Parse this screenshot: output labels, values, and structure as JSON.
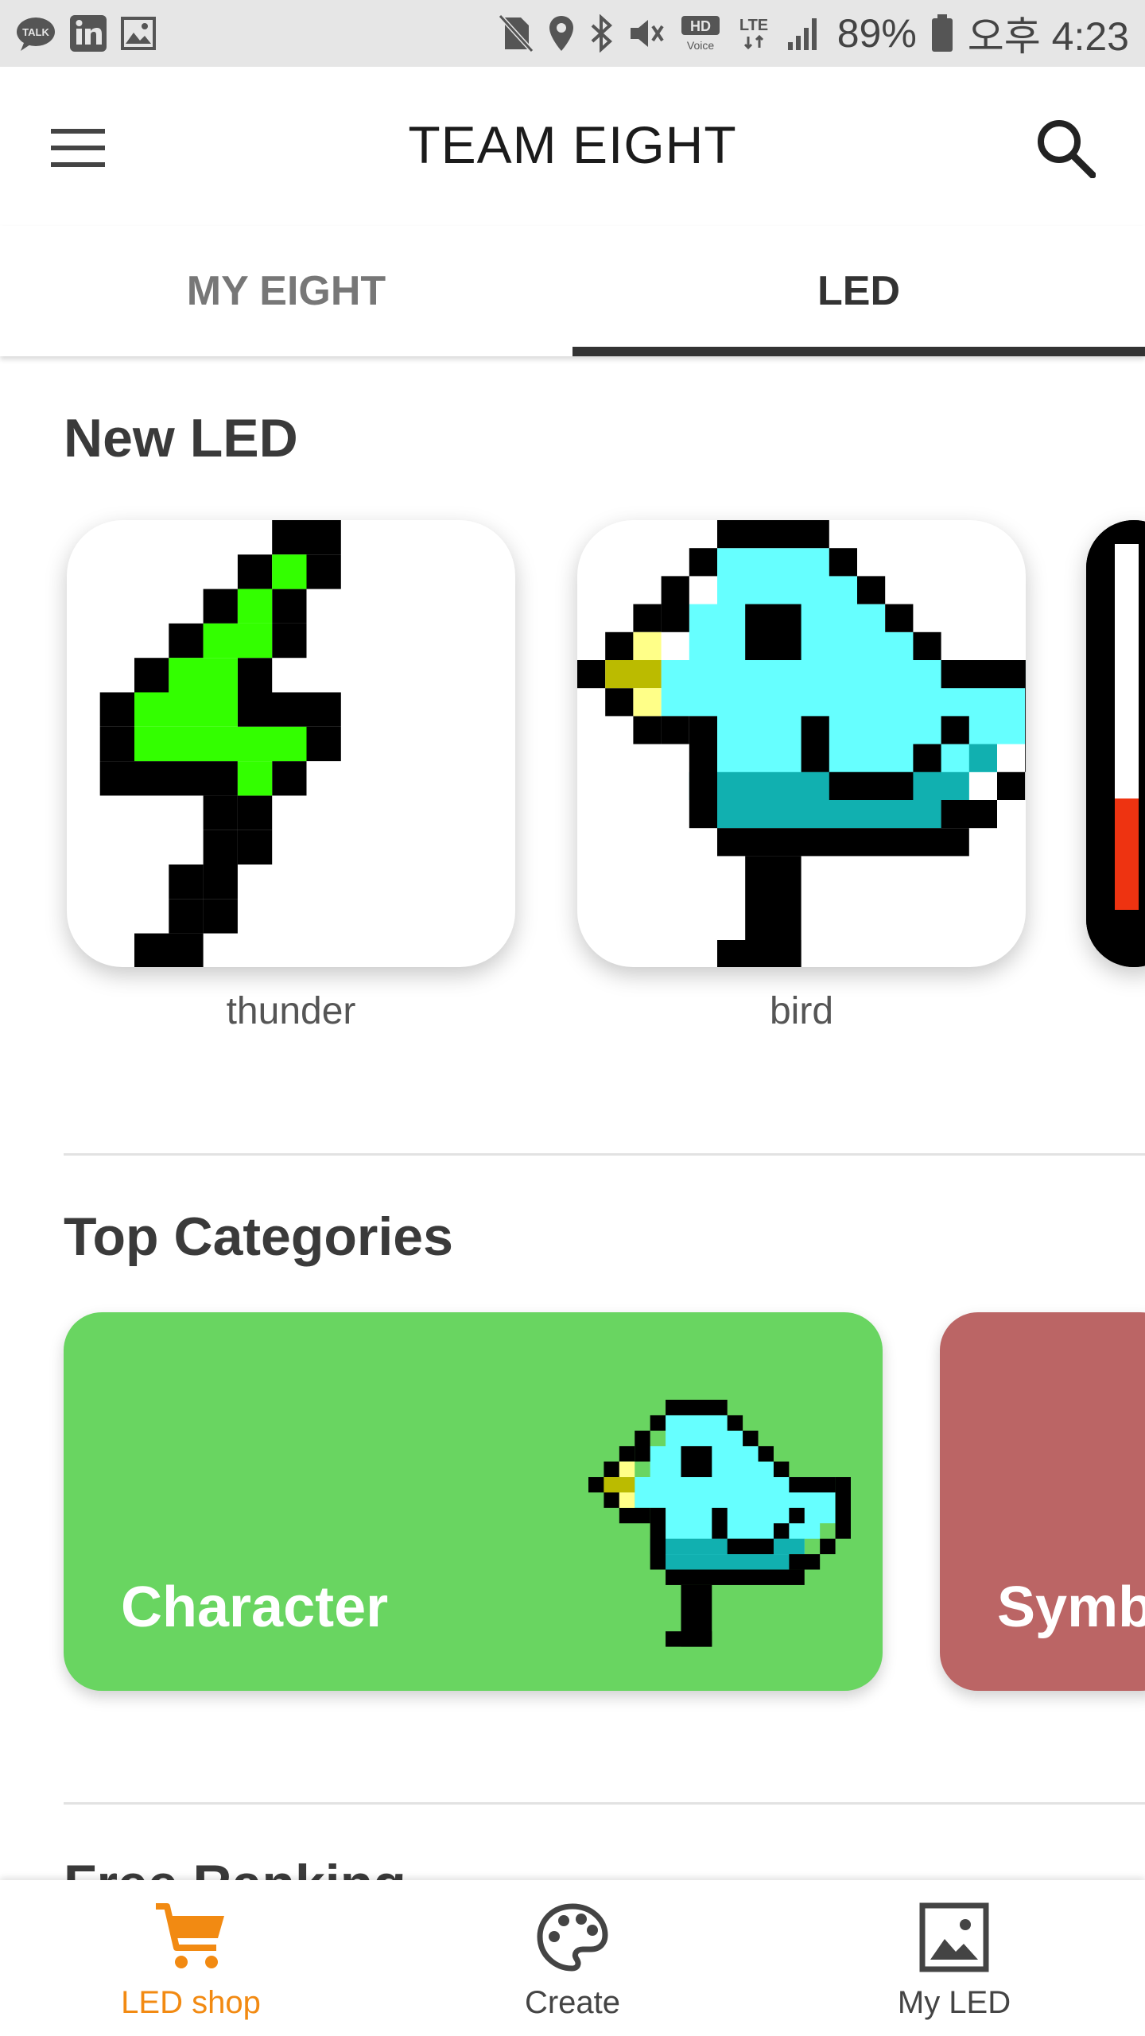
{
  "status_bar": {
    "left_icons": [
      "talk-icon",
      "linkedin-icon",
      "gallery-icon"
    ],
    "right_icons": [
      "no-sim-icon",
      "location-icon",
      "bluetooth-icon",
      "mute-icon",
      "hd-voice-icon",
      "lte-icon",
      "signal-icon",
      "battery-icon"
    ],
    "battery": "89%",
    "time": "오후 4:23"
  },
  "app_bar": {
    "title": "TEAM EIGHT",
    "menu_icon": "menu-icon",
    "search_icon": "search-icon"
  },
  "tabs": [
    {
      "label": "MY EIGHT",
      "active": false
    },
    {
      "label": "LED",
      "active": true
    }
  ],
  "new_led": {
    "title": "New LED",
    "items": [
      {
        "label": "thunder",
        "icon": "lightning-pixel-art"
      },
      {
        "label": "bird",
        "icon": "bird-pixel-art"
      }
    ]
  },
  "top_categories": {
    "title": "Top Categories",
    "items": [
      {
        "label": "Character",
        "color": "#69d561"
      },
      {
        "label": "Symb",
        "color": "#bb6565"
      }
    ]
  },
  "free_ranking": {
    "title": "Free Ranking"
  },
  "bottom_nav": {
    "items": [
      {
        "label": "LED shop",
        "icon": "cart-icon",
        "active": true,
        "color": "#f28a12"
      },
      {
        "label": "Create",
        "icon": "palette-icon",
        "active": false
      },
      {
        "label": "My LED",
        "icon": "image-icon",
        "active": false
      }
    ]
  }
}
